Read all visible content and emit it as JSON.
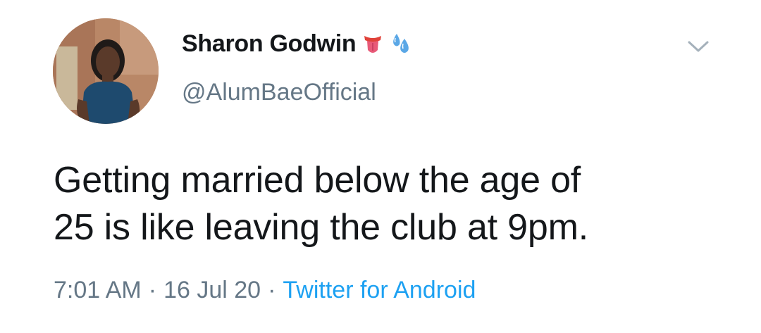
{
  "tweet": {
    "author": {
      "display_name": "Sharon Godwin",
      "handle": "@AlumBaeOfficial",
      "name_emojis": [
        "tongue-emoji",
        "droplets-emoji"
      ]
    },
    "text_lines": [
      "Getting married below the age of",
      "25 is like leaving the club at 9pm."
    ],
    "time": "7:01 AM",
    "separator": "·",
    "date": "16 Jul 20",
    "source": "Twitter for Android"
  },
  "colors": {
    "text": "#14171a",
    "secondary": "#657786",
    "link": "#1da1f2",
    "background": "#ffffff"
  },
  "icons": {
    "more": "chevron-down-icon"
  }
}
